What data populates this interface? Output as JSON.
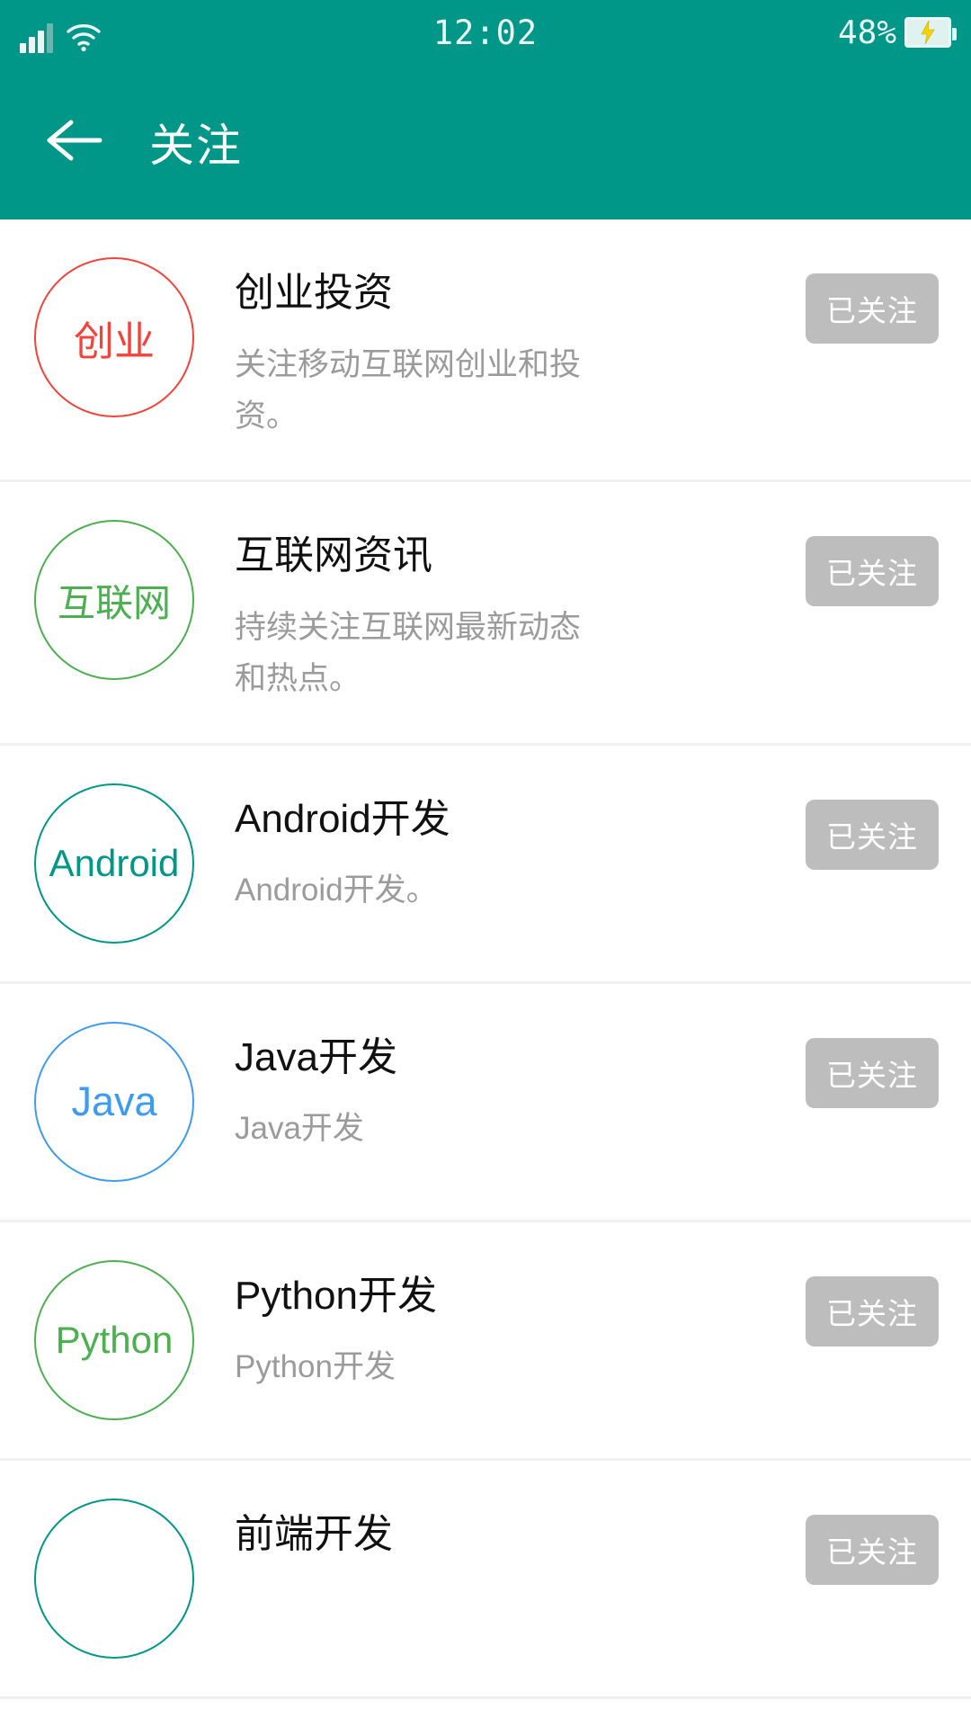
{
  "statusbar": {
    "time": "12:02",
    "battery_percent": "48%",
    "icons": {
      "signal": "signal-bars-icon",
      "wifi": "wifi-icon",
      "battery": "battery-charging-icon"
    }
  },
  "appbar": {
    "back_icon": "arrow-left-icon",
    "title": "关注",
    "background": "#009688"
  },
  "list": {
    "follow_label": "已关注",
    "items": [
      {
        "avatar_text": "创业",
        "avatar_color": "#f4433b",
        "title": "创业投资",
        "desc": "关注移动互联网创业和投资。",
        "followed_label": "已关注"
      },
      {
        "avatar_text": "互联网",
        "avatar_color": "#4caf50",
        "title": "互联网资讯",
        "desc": "持续关注互联网最新动态和热点。",
        "followed_label": "已关注"
      },
      {
        "avatar_text": "Android",
        "avatar_color": "#009688",
        "title": "Android开发",
        "desc": "Android开发。",
        "followed_label": "已关注"
      },
      {
        "avatar_text": "Java",
        "avatar_color": "#3d9bf0",
        "title": "Java开发",
        "desc": "Java开发",
        "followed_label": "已关注"
      },
      {
        "avatar_text": "Python",
        "avatar_color": "#4caf50",
        "title": "Python开发",
        "desc": "Python开发",
        "followed_label": "已关注"
      },
      {
        "avatar_text": "",
        "avatar_color": "#009688",
        "title": "前端开发",
        "desc": "",
        "followed_label": "已关注"
      }
    ]
  }
}
